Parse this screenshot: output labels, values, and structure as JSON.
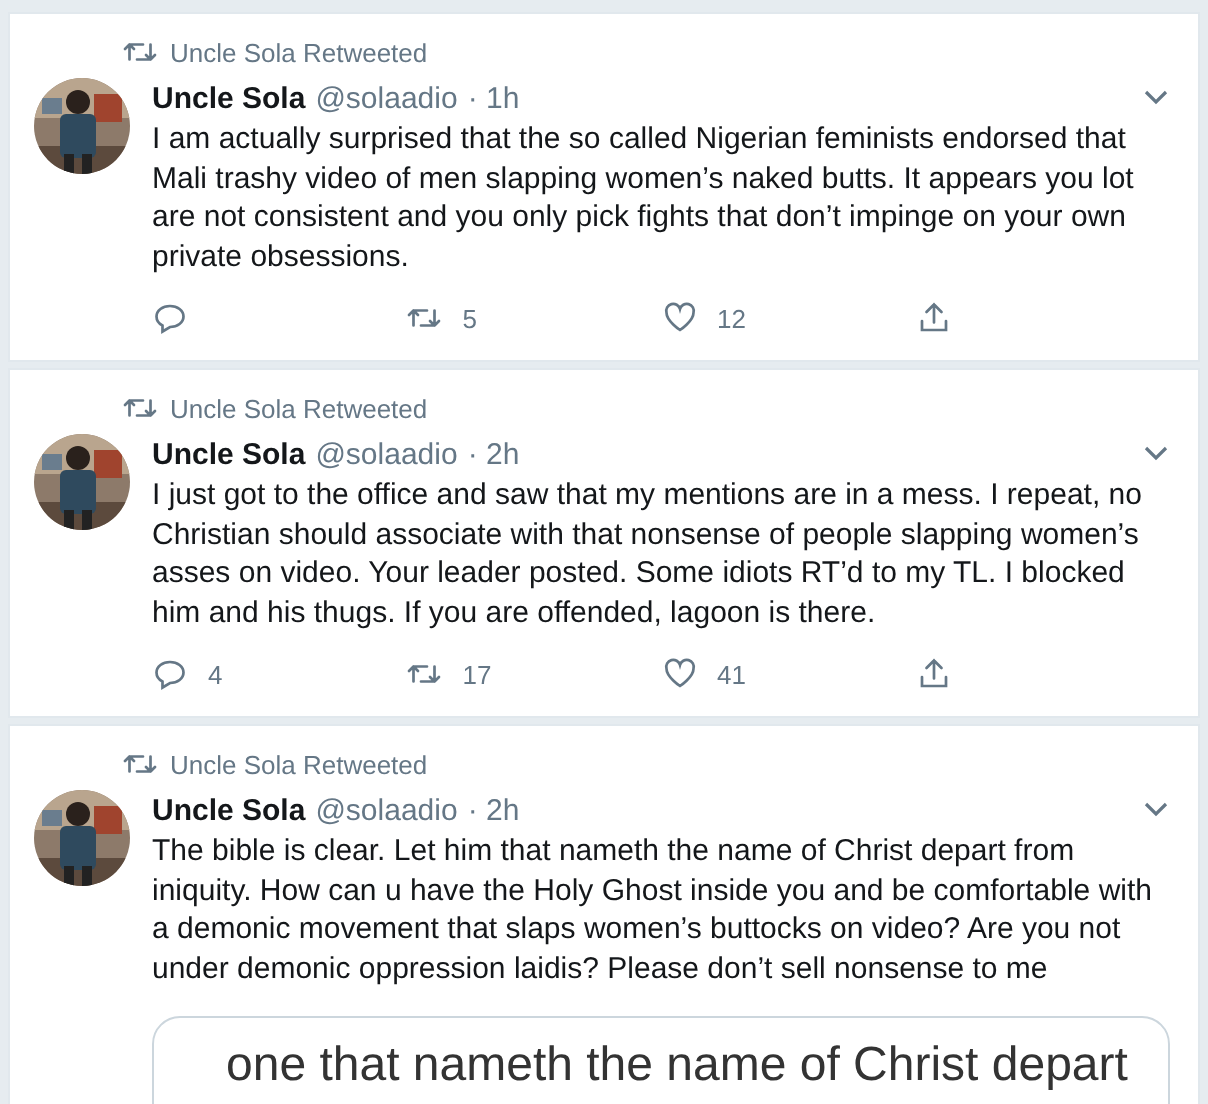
{
  "tweets": [
    {
      "retweeted_by": "Uncle Sola Retweeted",
      "name": "Uncle Sola",
      "handle": "@solaadio",
      "time": "· 1h",
      "text": "I am actually surprised that the so called Nigerian feminists endorsed that Mali trashy video of men slapping women’s naked butts. It appears you lot are not consistent and you only pick fights that don’t impinge on your own private obsessions.",
      "actions": {
        "retweets": "5",
        "likes": "12"
      }
    },
    {
      "retweeted_by": "Uncle Sola Retweeted",
      "name": "Uncle Sola",
      "handle": "@solaadio",
      "time": "· 2h",
      "text": "I just got to the office and saw that my mentions are in a mess. I repeat, no Christian should associate with that nonsense of people slapping women’s asses on video. Your leader posted. Some idiots RT’d to my TL. I blocked him and his thugs. If you are offended, lagoon is there.",
      "actions": {
        "replies": "4",
        "retweets": "17",
        "likes": "41"
      }
    },
    {
      "retweeted_by": "Uncle Sola Retweeted",
      "name": "Uncle Sola",
      "handle": "@solaadio",
      "time": "· 2h",
      "text": "The bible is clear. Let him that nameth the name of Christ depart from iniquity. How can u have the Holy Ghost inside you and be comfortable with a demonic movement that slaps women’s buttocks on video? Are you not under demonic oppression laidis? Please don’t sell nonsense to me",
      "attachment": {
        "text": "one that nameth the name of Christ depart"
      }
    }
  ]
}
